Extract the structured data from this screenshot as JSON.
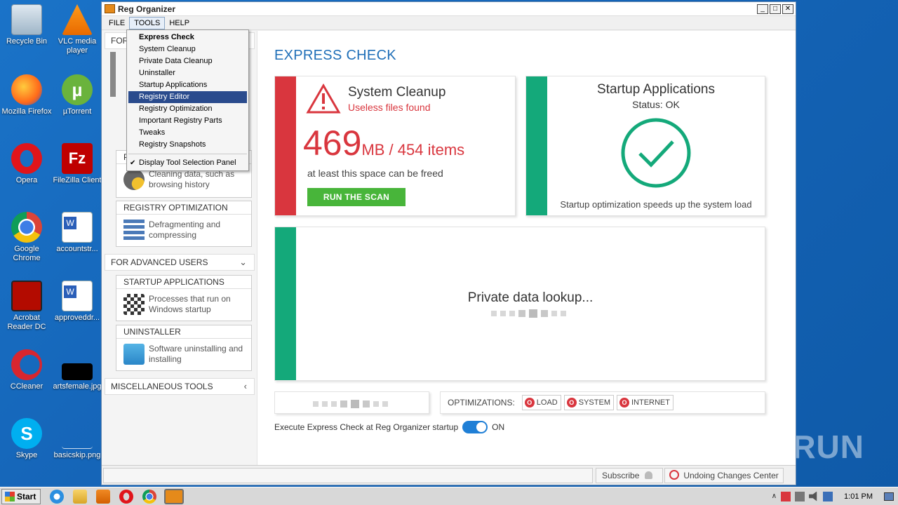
{
  "desktop": {
    "icons": [
      {
        "label": "Recycle Bin"
      },
      {
        "label": "VLC media player"
      },
      {
        "label": "Mozilla Firefox"
      },
      {
        "label": "µTorrent"
      },
      {
        "label": "Opera"
      },
      {
        "label": "FileZilla Client"
      },
      {
        "label": "Google Chrome"
      },
      {
        "label": "accountstr..."
      },
      {
        "label": "Acrobat Reader DC"
      },
      {
        "label": "approveddr..."
      },
      {
        "label": "CCleaner"
      },
      {
        "label": "artsfemale.jpg"
      },
      {
        "label": "Skype"
      },
      {
        "label": "basicskip.png"
      }
    ],
    "watermark": "ANY RUN"
  },
  "window": {
    "title": "Reg Organizer",
    "controls": {
      "minimize": "_",
      "maximize": "□",
      "close": "✕"
    },
    "menu": {
      "file": "FILE",
      "tools": "TOOLS",
      "help": "HELP"
    }
  },
  "tools_menu": {
    "items": [
      {
        "label": "Express Check"
      },
      {
        "label": "System Cleanup"
      },
      {
        "label": "Private Data Cleanup"
      },
      {
        "label": "Uninstaller"
      },
      {
        "label": "Startup Applications"
      },
      {
        "label": "Registry Editor"
      },
      {
        "label": "Registry Optimization"
      },
      {
        "label": "Important Registry Parts"
      },
      {
        "label": "Tweaks"
      },
      {
        "label": "Registry Snapshots"
      }
    ],
    "display_panel": "Display Tool Selection Panel",
    "check_mark": "✔"
  },
  "left_panel": {
    "top_section_partial": "FOR",
    "private_partial_title": "P",
    "private_desc": "Cleaning data, such as browsing history",
    "registry_opt": {
      "title": "REGISTRY OPTIMIZATION",
      "desc": "Defragmenting and compressing"
    },
    "advanced_header": "FOR ADVANCED USERS",
    "startup": {
      "title": "STARTUP APPLICATIONS",
      "desc": "Processes that run on Windows startup"
    },
    "uninstaller": {
      "title": "UNINSTALLER",
      "desc": "Software uninstalling and installing"
    },
    "misc_header": "MISCELLANEOUS TOOLS"
  },
  "express_check": {
    "title": "EXPRESS CHECK",
    "system_cleanup": {
      "heading": "System Cleanup",
      "subheading": "Useless files found",
      "size_number": "469",
      "size_rest": "MB / 454 items",
      "note": "at least this space can be freed",
      "button": "RUN THE SCAN"
    },
    "startup_apps": {
      "heading": "Startup Applications",
      "status": "Status: OK",
      "note": "Startup optimization speeds up the system load"
    },
    "private_data": {
      "label": "Private data lookup..."
    },
    "optimizations": {
      "label": "OPTIMIZATIONS:",
      "buttons": [
        {
          "label": "LOAD"
        },
        {
          "label": "SYSTEM"
        },
        {
          "label": "INTERNET"
        }
      ]
    },
    "startup_toggle": {
      "label": "Execute Express Check at Reg Organizer startup",
      "state": "ON"
    }
  },
  "statusbar": {
    "subscribe": "Subscribe",
    "undo_center": "Undoing Changes Center"
  },
  "taskbar": {
    "start": "Start",
    "clock": "1:01 PM"
  },
  "colors": {
    "accent_red": "#d9363e",
    "accent_green": "#14a97a",
    "title_blue": "#1f6fb8",
    "button_green": "#48b53a"
  }
}
